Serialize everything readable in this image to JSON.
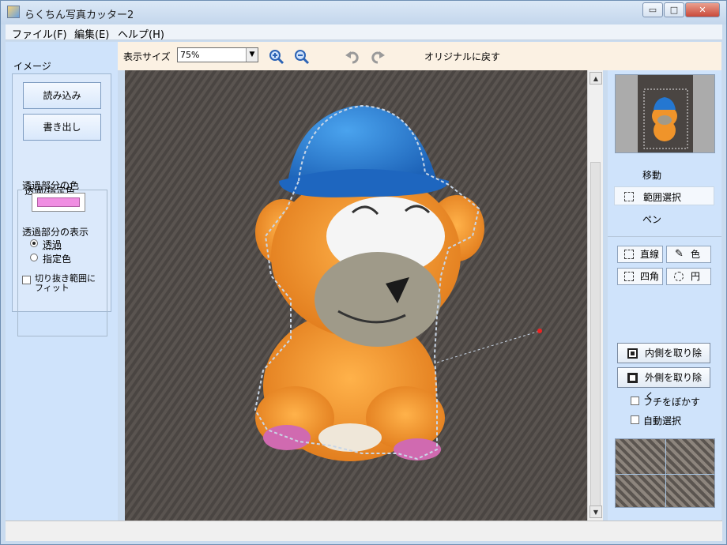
{
  "window": {
    "title": "らくちん写真カッター2",
    "min": "▭",
    "max": "□",
    "close": "✕"
  },
  "menu": [
    "ファイル(F)",
    "編集(E)",
    "ヘルプ(H)"
  ],
  "toolbar": {
    "zoom_label": "表示サイズ",
    "zoom_value": "75%",
    "reset": "オリジナルに戻す"
  },
  "left": {
    "heading": "イメージ",
    "load": "読み込み",
    "export": "書き出し",
    "group_title": "透過/指定色",
    "color_label": "透過部分の色",
    "display_label": "透過部分の表示",
    "opt_transparent": "透過",
    "opt_color": "指定色",
    "fit_check": "切り抜き範囲に\nフィット"
  },
  "right": {
    "mode_move": "移動",
    "mode_range": "範囲選択",
    "mode_pen": "ペン",
    "tool_line": "直線",
    "tool_color": "色",
    "tool_rect": "四角",
    "tool_circle": "円",
    "remove_inside": "内側を取り除く",
    "remove_outside": "外側を取り除く",
    "blur_edge": "フチをぼかす",
    "auto_select": "自動選択"
  },
  "colors": {
    "accent": "#6a9be0",
    "transparent_color": "#f08ee2"
  },
  "icons": {
    "zoom_in": "zoom-in-icon",
    "zoom_out": "zoom-out-icon",
    "undo": "undo-icon",
    "redo": "redo-icon"
  }
}
